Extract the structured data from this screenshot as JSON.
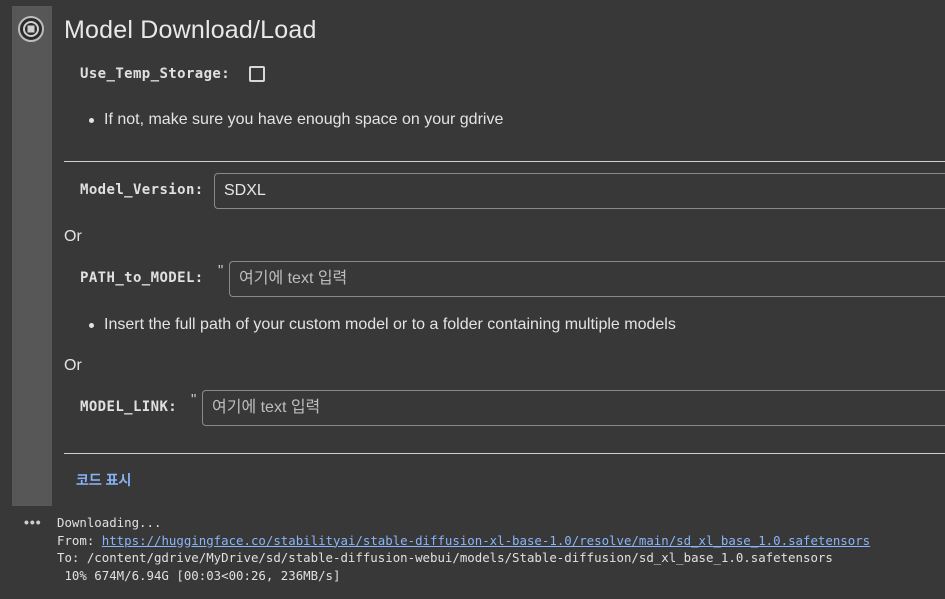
{
  "form": {
    "title": "Model Download/Load",
    "use_temp_storage": {
      "label": "Use_Temp_Storage:",
      "checked": false
    },
    "note_storage": "If not, make sure you have enough space on your gdrive",
    "model_version": {
      "label": "Model_Version:",
      "value": "SDXL"
    },
    "or_1": "Or",
    "path_to_model": {
      "label": "PATH_to_MODEL:",
      "quote": "\"",
      "placeholder": "여기에 text 입력"
    },
    "note_path": "Insert the full path of your custom model or to a folder containing multiple models",
    "or_2": "Or",
    "model_link": {
      "label": "MODEL_LINK:",
      "quote": "\"",
      "placeholder": "여기에 text 입력"
    },
    "show_code": "코드 표시"
  },
  "output": {
    "menu": "•••",
    "line1": "Downloading...",
    "from_prefix": "From: ",
    "from_url": "https://huggingface.co/stabilityai/stable-diffusion-xl-base-1.0/resolve/main/sd_xl_base_1.0.safetensors",
    "line3": "To: /content/gdrive/MyDrive/sd/stable-diffusion-webui/models/Stable-diffusion/sd_xl_base_1.0.safetensors",
    "line4": " 10% 674M/6.94G [00:03<00:26, 236MB/s]"
  },
  "colors": {
    "background": "#383838",
    "gutter": "#575757",
    "link": "#8ab4f8"
  }
}
